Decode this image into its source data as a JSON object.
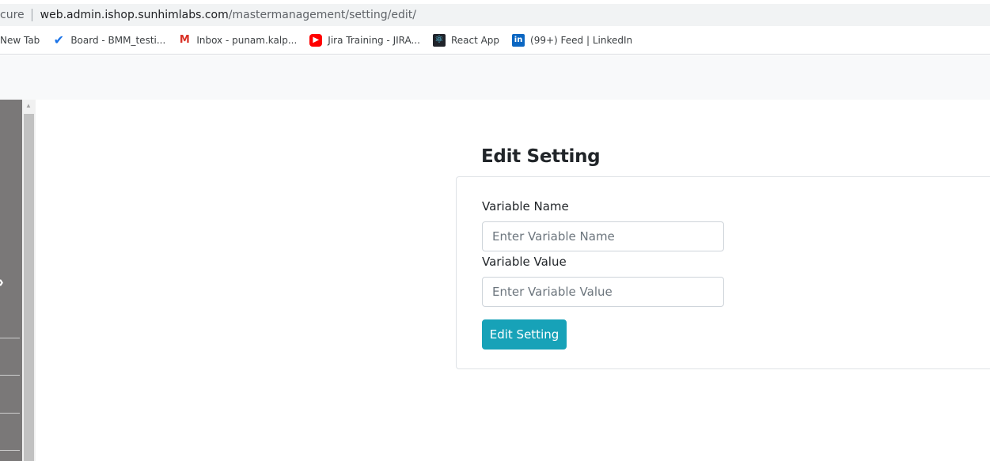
{
  "browser": {
    "security_label": "cure",
    "url_host": "web.admin.ishop.sunhimlabs.com",
    "url_path": "/mastermanagement/setting/edit/"
  },
  "bookmarks": [
    {
      "label": "New Tab",
      "icon": "none"
    },
    {
      "label": "Board - BMM_testi...",
      "icon": "board-icon",
      "glyph": "✔"
    },
    {
      "label": "Inbox - punam.kalp...",
      "icon": "gmail-icon",
      "glyph": "M"
    },
    {
      "label": "Jira Training - JIRA...",
      "icon": "youtube-icon",
      "glyph": "▶"
    },
    {
      "label": "React App",
      "icon": "react-icon",
      "glyph": "⚛"
    },
    {
      "label": "(99+) Feed | LinkedIn",
      "icon": "linkedin-icon",
      "glyph": "in"
    }
  ],
  "sidebar": {
    "toggle_glyph": "›"
  },
  "form": {
    "title": "Edit Setting",
    "variable_name_label": "Variable Name",
    "variable_name_placeholder": "Enter Variable Name",
    "variable_name_value": "",
    "variable_value_label": "Variable Value",
    "variable_value_placeholder": "Enter Variable Value",
    "variable_value_value": "",
    "submit_label": "Edit Setting"
  },
  "colors": {
    "primary_button": "#17a2b8",
    "sidebar": "#7a7878"
  }
}
